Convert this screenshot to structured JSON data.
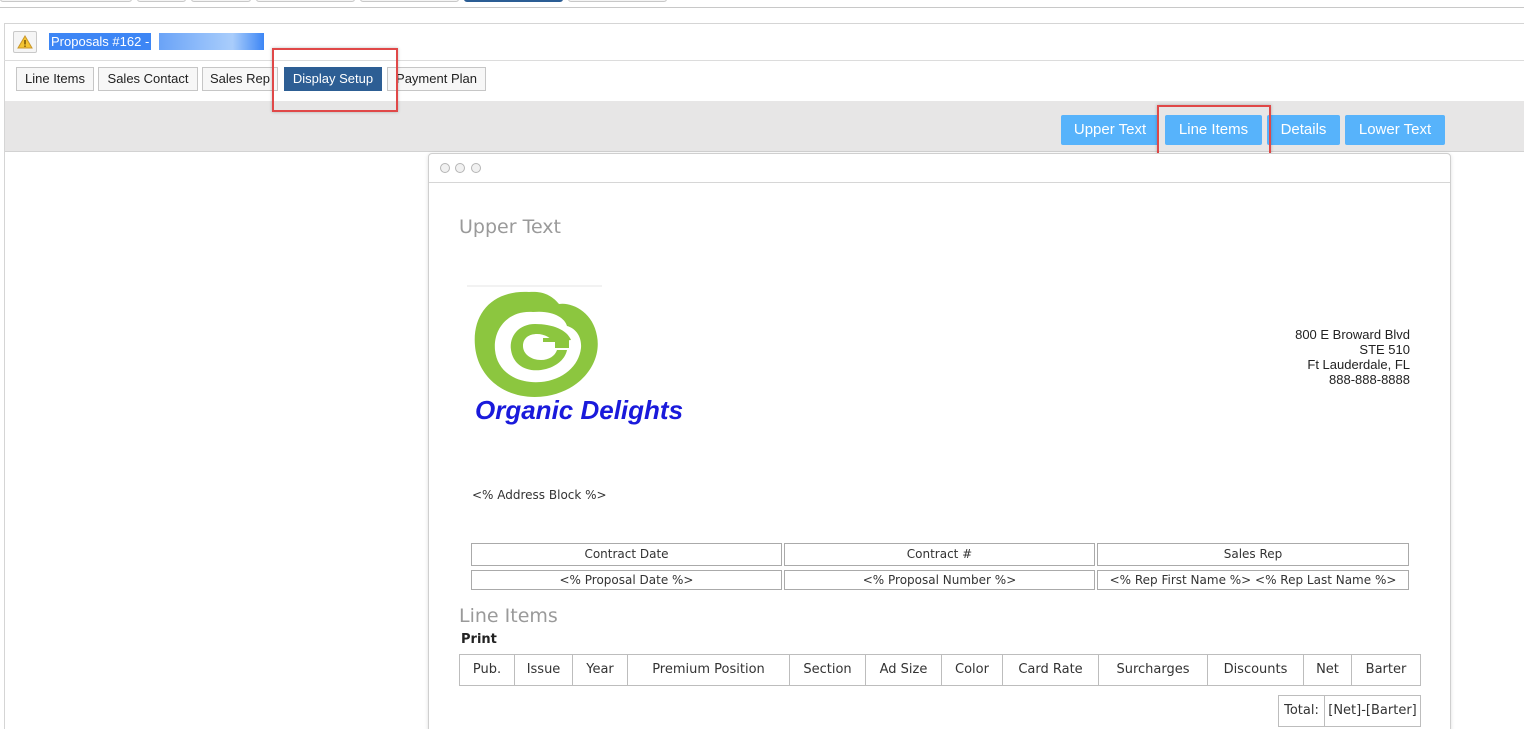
{
  "header": {
    "title": "Proposals #162 - "
  },
  "sub_tabs": [
    {
      "label": "Line Items",
      "active": false
    },
    {
      "label": "Sales Contact",
      "active": false
    },
    {
      "label": "Sales Rep",
      "active": false
    },
    {
      "label": "Display Setup",
      "active": true
    },
    {
      "label": "Payment Plan",
      "active": false
    }
  ],
  "toolbar": {
    "buttons": [
      {
        "label": "Upper Text"
      },
      {
        "label": "Line Items"
      },
      {
        "label": "Details"
      },
      {
        "label": "Lower Text"
      }
    ]
  },
  "preview": {
    "upper_heading": "Upper Text",
    "logo_text": "Organic Delights",
    "address_lines": [
      "800 E Broward Blvd",
      "STE 510",
      "Ft Lauderdale, FL",
      "888-888-8888"
    ],
    "address_block": "<% Address Block %>",
    "contract_table": {
      "headers": [
        "Contract Date",
        "Contract #",
        "Sales Rep"
      ],
      "values": [
        "<% Proposal Date %>",
        "<% Proposal Number %>",
        "<% Rep First Name %> <% Rep Last Name %>"
      ]
    },
    "line_items_heading": "Line Items",
    "print_label": "Print",
    "line_item_columns": [
      "Pub.",
      "Issue",
      "Year",
      "Premium Position",
      "Section",
      "Ad Size",
      "Color",
      "Card Rate",
      "Surcharges",
      "Discounts",
      "Net",
      "Barter"
    ],
    "total_label": "Total:",
    "total_value": "[Net]-[Barter]"
  },
  "colors": {
    "accent": "#2d5e94",
    "toolbar_button": "#57b3fb",
    "highlight_box": "#e04848",
    "logo_green": "#8cc63f",
    "logo_text": "#1a1adb"
  }
}
